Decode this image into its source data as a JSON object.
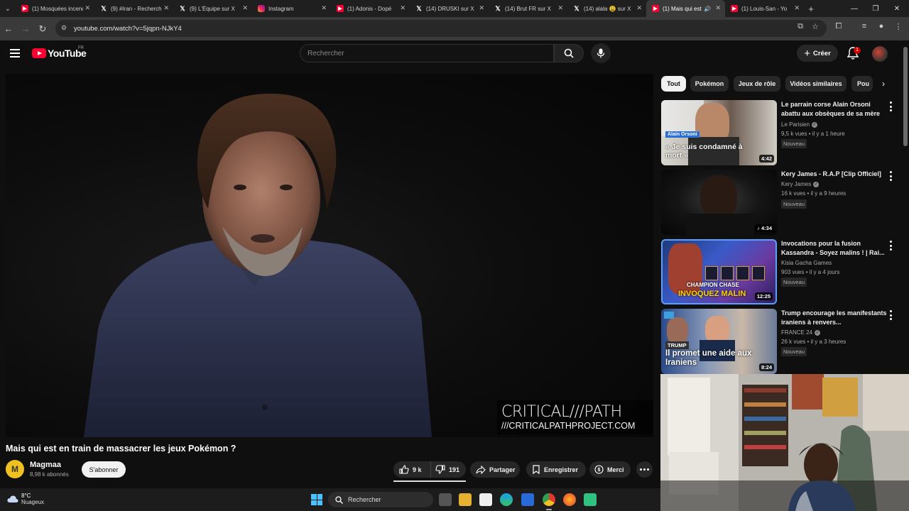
{
  "browser": {
    "tabs": [
      {
        "label": "(1) Mosquées incendiées",
        "favicon": "youtube-icon",
        "active": false
      },
      {
        "label": "(9) #Iran - Recherche",
        "favicon": "x-icon",
        "active": false
      },
      {
        "label": "(9) L'Équipe sur X",
        "favicon": "x-icon",
        "active": false
      },
      {
        "label": "Instagram",
        "favicon": "instagram-icon",
        "active": false
      },
      {
        "label": "(1) Adonis - Dopé",
        "favicon": "youtube-icon",
        "active": false
      },
      {
        "label": "(14) DRUSKI sur X",
        "favicon": "x-icon",
        "active": false
      },
      {
        "label": "(14) Brut FR sur X",
        "favicon": "x-icon",
        "active": false
      },
      {
        "label": "(14) alala 😩 sur X",
        "favicon": "x-icon",
        "active": false
      },
      {
        "label": "(1) Mais qui est",
        "favicon": "youtube-icon",
        "active": true
      },
      {
        "label": "(1) Louis-San - Yo",
        "favicon": "youtube-icon",
        "active": false
      }
    ],
    "url": "youtube.com/watch?v=5jqpn-NJkY4"
  },
  "youtube": {
    "logo_text": "YouTube",
    "region": "FR",
    "search_placeholder": "Rechercher",
    "create_label": "Créer",
    "notification_count": "1"
  },
  "video": {
    "watermark_line1": "CRITICAL///PATH",
    "watermark_line2": "///CRITICALPATHPROJECT.COM",
    "title": "Mais qui est en train de massacrer les jeux Pokémon ?",
    "channel": "Magmaa",
    "subscribers": "8,98 k abonnés",
    "subscribe_label": "S'abonner",
    "likes": "9 k",
    "dislikes": "191",
    "share_label": "Partager",
    "save_label": "Enregistrer",
    "thanks_label": "Merci"
  },
  "chips": [
    "Tout",
    "Pokémon",
    "Jeux de rôle",
    "Vidéos similaires",
    "Pou"
  ],
  "recommendations": [
    {
      "title": "Le parrain corse Alain Orsoni abattu aux obsèques de sa mère",
      "channel": "Le Parisien",
      "verified": true,
      "views": "9,5 k vues",
      "age": "il y a 1 heure",
      "badge": "Nouveau",
      "duration": "4:42",
      "thumb_tag": "Alain Orsoni",
      "thumb_caption": "« Je suis condamné à mort »"
    },
    {
      "title": "Kery James - R.A.P [Clip Officiel]",
      "channel": "Kery James",
      "verified": true,
      "views": "16 k vues",
      "age": "il y a 9 heures",
      "badge": "Nouveau",
      "duration": "4:34"
    },
    {
      "title": "Invocations pour la fusion Kassandra - Soyez malins ! | Rai...",
      "channel": "Kisia Gacha Games",
      "verified": false,
      "views": "903 vues",
      "age": "il y a 4 jours",
      "badge": "Nouveau",
      "duration": "12:25",
      "thumb_caption1": "CHAMPION CHASE",
      "thumb_caption2": "INVOQUEZ MALIN"
    },
    {
      "title": "Trump encourage les manifestants iraniens à renvers...",
      "channel": "FRANCE 24",
      "verified": true,
      "views": "26 k vues",
      "age": "il y a 3 heures",
      "badge": "Nouveau",
      "duration": "8:24",
      "thumb_tag": "TRUMP",
      "thumb_caption": "Il promet une aide aux Iraniens"
    }
  ],
  "taskbar": {
    "temperature": "8°C",
    "weather": "Nuageux",
    "search_label": "Rechercher"
  },
  "colors": {
    "yt_red": "#ff0033",
    "background": "#0f0f0f",
    "chip_bg": "#272727"
  }
}
